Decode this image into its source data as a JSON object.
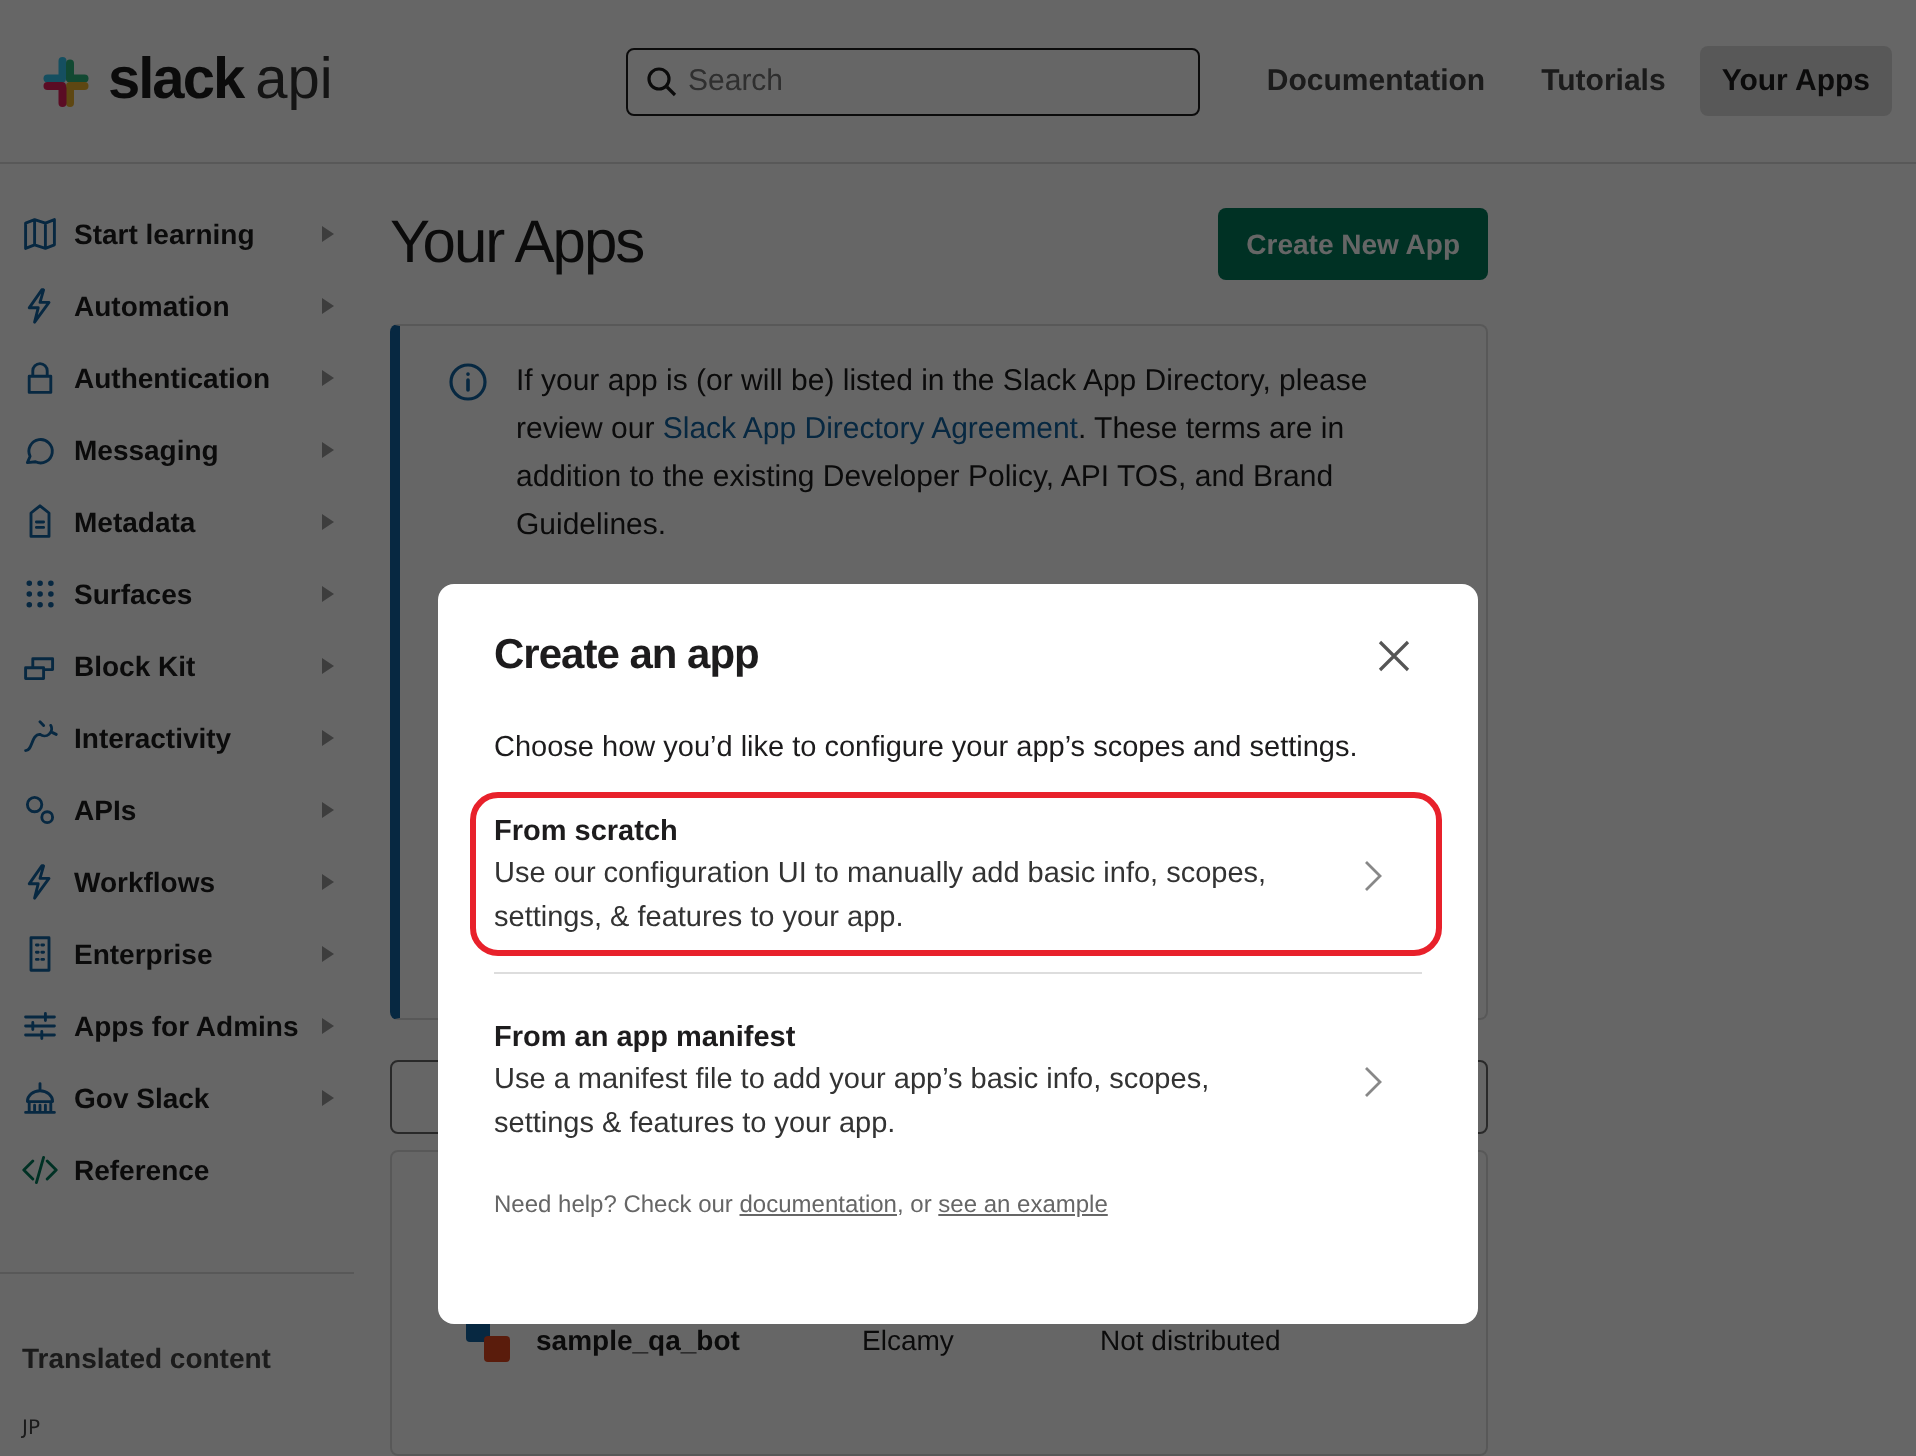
{
  "header": {
    "logo_word": "slack",
    "logo_suffix": "api",
    "search": {
      "placeholder": "Search"
    },
    "nav": [
      {
        "label": "Documentation",
        "selected": false
      },
      {
        "label": "Tutorials",
        "selected": false
      },
      {
        "label": "Your Apps",
        "selected": true
      }
    ]
  },
  "sidebar": {
    "items": [
      {
        "label": "Start learning",
        "has_submenu": true
      },
      {
        "label": "Automation",
        "has_submenu": true
      },
      {
        "label": "Authentication",
        "has_submenu": true
      },
      {
        "label": "Messaging",
        "has_submenu": true
      },
      {
        "label": "Metadata",
        "has_submenu": true
      },
      {
        "label": "Surfaces",
        "has_submenu": true
      },
      {
        "label": "Block Kit",
        "has_submenu": true
      },
      {
        "label": "Interactivity",
        "has_submenu": true
      },
      {
        "label": "APIs",
        "has_submenu": true
      },
      {
        "label": "Workflows",
        "has_submenu": true
      },
      {
        "label": "Enterprise",
        "has_submenu": true
      },
      {
        "label": "Apps for Admins",
        "has_submenu": true
      },
      {
        "label": "Gov Slack",
        "has_submenu": true
      },
      {
        "label": "Reference",
        "has_submenu": false
      }
    ],
    "footer_title": "Translated content",
    "language": "JP"
  },
  "main": {
    "title": "Your Apps",
    "create_button": "Create New App",
    "notice": {
      "before": "If your app is (or will be) listed in the Slack App Directory, please review our ",
      "link": "Slack App Directory Agreement",
      "after": ". These terms are in addition to the existing Developer Policy, API TOS, and Brand Guidelines."
    },
    "apps": [
      {
        "name": "sample_qa_bot",
        "column_2": "Elcamy",
        "column_3": "Not distributed"
      }
    ]
  },
  "modal": {
    "title": "Create an app",
    "subtitle": "Choose how you’d like to configure your app’s scopes and settings.",
    "options": [
      {
        "title": "From scratch",
        "description": "Use our configuration UI to manually add basic info, scopes, settings, & features to your app.",
        "highlighted": true
      },
      {
        "title": "From an app manifest",
        "description": "Use a manifest file to add your app’s basic info, scopes, settings & features to your app.",
        "highlighted": false
      }
    ],
    "help": {
      "before": "Need help? Check our ",
      "link_1": "documentation",
      "middle": ", or ",
      "link_2": "see an example"
    }
  }
}
